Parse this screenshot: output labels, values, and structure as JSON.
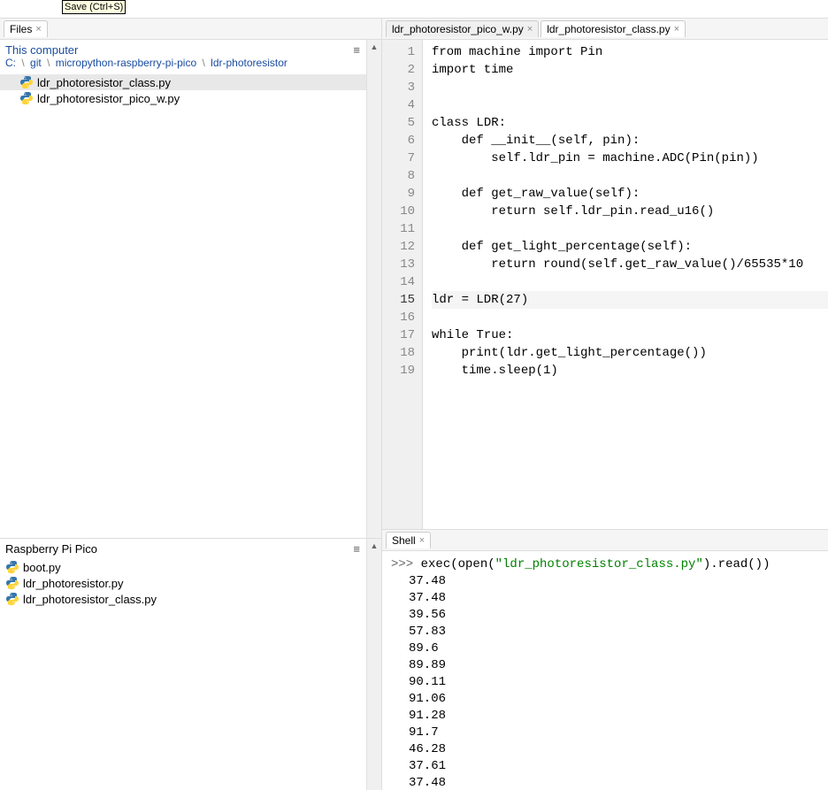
{
  "toolbar": {
    "save_hint": "Save (Ctrl+S)"
  },
  "files_panel": {
    "tab_label": "Files",
    "header": "This computer",
    "breadcrumb": [
      "C:",
      "git",
      "micropython-raspberry-pi-pico",
      "ldr-photoresistor"
    ],
    "menu_icon": "≡",
    "items": [
      {
        "name": "ldr_photoresistor_class.py",
        "selected": true
      },
      {
        "name": "ldr_photoresistor_pico_w.py",
        "selected": false
      }
    ]
  },
  "device_panel": {
    "header": "Raspberry Pi Pico",
    "menu_icon": "≡",
    "items": [
      {
        "name": "boot.py"
      },
      {
        "name": "ldr_photoresistor.py"
      },
      {
        "name": "ldr_photoresistor_class.py"
      }
    ]
  },
  "editor": {
    "tabs": [
      {
        "label": "ldr_photoresistor_pico_w.py",
        "active": false
      },
      {
        "label": "ldr_photoresistor_class.py",
        "active": true
      }
    ],
    "active_line": 15,
    "lines": [
      {
        "n": 1,
        "tokens": [
          [
            "kw",
            "from"
          ],
          [
            "t",
            " machine "
          ],
          [
            "kw",
            "import"
          ],
          [
            "t",
            " Pin"
          ]
        ]
      },
      {
        "n": 2,
        "tokens": [
          [
            "kw",
            "import"
          ],
          [
            "t",
            " time"
          ]
        ]
      },
      {
        "n": 3,
        "tokens": []
      },
      {
        "n": 4,
        "tokens": []
      },
      {
        "n": 5,
        "tokens": [
          [
            "kw",
            "class"
          ],
          [
            "t",
            " "
          ],
          [
            "fname",
            "LDR"
          ],
          [
            "t",
            ":"
          ]
        ]
      },
      {
        "n": 6,
        "tokens": [
          [
            "t",
            "    "
          ],
          [
            "kw",
            "def"
          ],
          [
            "t",
            " "
          ],
          [
            "fname",
            "__init__"
          ],
          [
            "t",
            "("
          ],
          [
            "self",
            "self"
          ],
          [
            "t",
            ", pin):"
          ]
        ]
      },
      {
        "n": 7,
        "tokens": [
          [
            "t",
            "        "
          ],
          [
            "self",
            "self"
          ],
          [
            "t",
            ".ldr_pin = machine.ADC(Pin(pin))"
          ]
        ]
      },
      {
        "n": 8,
        "tokens": []
      },
      {
        "n": 9,
        "tokens": [
          [
            "t",
            "    "
          ],
          [
            "kw",
            "def"
          ],
          [
            "t",
            " "
          ],
          [
            "fname",
            "get_raw_value"
          ],
          [
            "t",
            "("
          ],
          [
            "self",
            "self"
          ],
          [
            "t",
            "):"
          ]
        ]
      },
      {
        "n": 10,
        "tokens": [
          [
            "t",
            "        "
          ],
          [
            "kw",
            "return"
          ],
          [
            "t",
            " "
          ],
          [
            "self",
            "self"
          ],
          [
            "t",
            ".ldr_pin.read_u16()"
          ]
        ]
      },
      {
        "n": 11,
        "tokens": []
      },
      {
        "n": 12,
        "tokens": [
          [
            "t",
            "    "
          ],
          [
            "kw",
            "def"
          ],
          [
            "t",
            " "
          ],
          [
            "fname",
            "get_light_percentage"
          ],
          [
            "t",
            "("
          ],
          [
            "self",
            "self"
          ],
          [
            "t",
            "):"
          ]
        ]
      },
      {
        "n": 13,
        "tokens": [
          [
            "t",
            "        "
          ],
          [
            "kw",
            "return"
          ],
          [
            "t",
            " round("
          ],
          [
            "self",
            "self"
          ],
          [
            "t",
            ".get_raw_value()/"
          ],
          [
            "num",
            "65535"
          ],
          [
            "star",
            "*"
          ],
          [
            "num",
            "10"
          ]
        ]
      },
      {
        "n": 14,
        "tokens": []
      },
      {
        "n": 15,
        "tokens": [
          [
            "t",
            "ldr = LDR("
          ],
          [
            "num",
            "27"
          ],
          [
            "t",
            ")"
          ]
        ]
      },
      {
        "n": 16,
        "tokens": []
      },
      {
        "n": 17,
        "tokens": [
          [
            "kw",
            "while"
          ],
          [
            "t",
            " "
          ],
          [
            "kw",
            "True"
          ],
          [
            "t",
            ":"
          ]
        ]
      },
      {
        "n": 18,
        "tokens": [
          [
            "t",
            "    print(ldr.get_light_percentage())"
          ]
        ]
      },
      {
        "n": 19,
        "tokens": [
          [
            "t",
            "    time.sleep("
          ],
          [
            "num",
            "1"
          ],
          [
            "t",
            ")"
          ]
        ]
      }
    ]
  },
  "shell": {
    "tab_label": "Shell",
    "prompt": ">>> ",
    "command_parts": [
      [
        "t",
        "exec(open("
      ],
      [
        "str",
        "\"ldr_photoresistor_class.py\""
      ],
      [
        "t",
        ").read())"
      ]
    ],
    "output": [
      "37.48",
      "37.48",
      "39.56",
      "57.83",
      "89.6",
      "89.89",
      "90.11",
      "91.06",
      "91.28",
      "91.7",
      "46.28",
      "37.61",
      "37.48"
    ]
  }
}
